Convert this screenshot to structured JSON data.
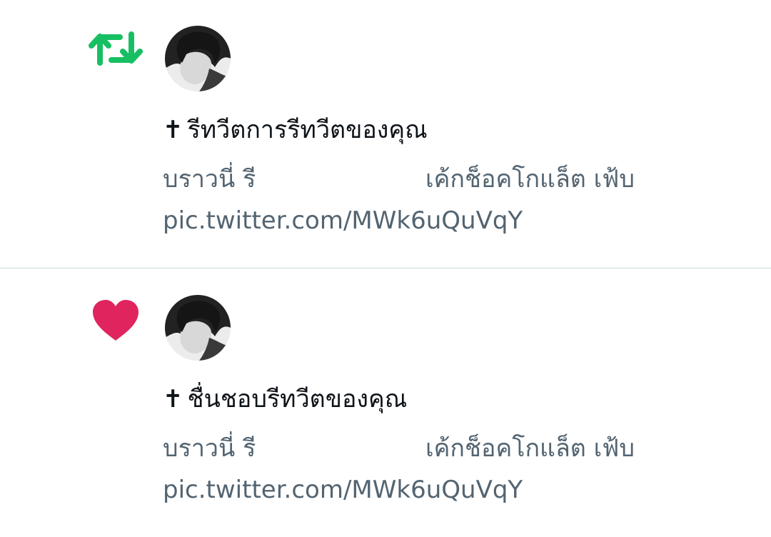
{
  "notifications": [
    {
      "type": "retweet",
      "icon": "retweet-icon",
      "icon_color": "#17bf63",
      "headline": "รีทวีตการรีทวีตของคุณ",
      "prefix_symbol": "✝",
      "preview": {
        "name": "บราวนี่ รี",
        "text": "เค้กช็อคโกแล็ต เฟ้บ",
        "link": "pic.twitter.com/MWk6uQuVqY"
      }
    },
    {
      "type": "like",
      "icon": "heart-icon",
      "icon_color": "#e0245e",
      "headline": "ชื่นชอบรีทวีตของคุณ",
      "prefix_symbol": "✝",
      "preview": {
        "name": "บราวนี่ รี",
        "text": "เค้กช็อคโกแล็ต เฟ้บ",
        "link": "pic.twitter.com/MWk6uQuVqY"
      }
    }
  ]
}
